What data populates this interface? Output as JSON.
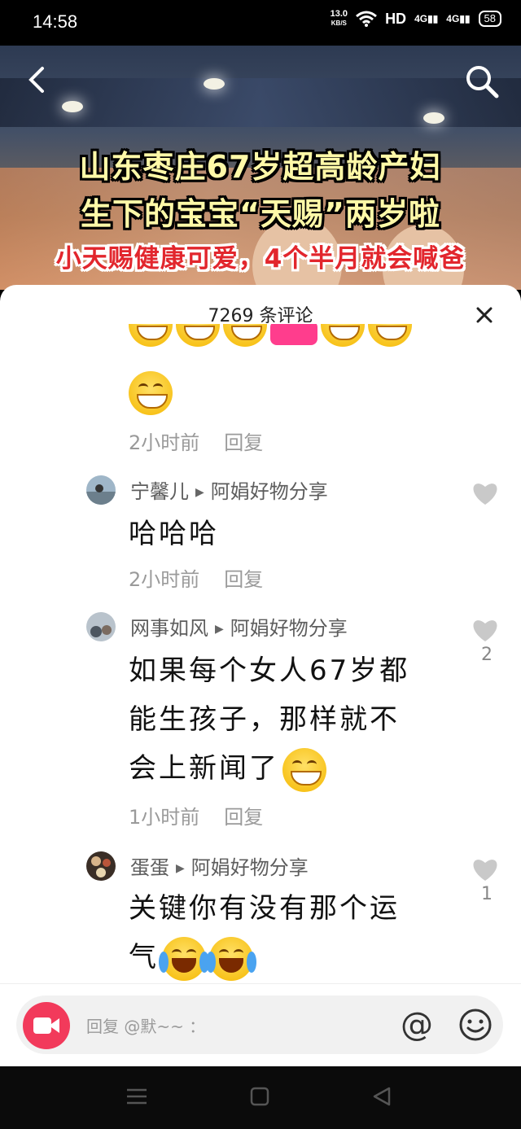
{
  "status_bar": {
    "time": "14:58",
    "net_speed": "13.0",
    "net_unit": "KB/S",
    "hd": "HD",
    "sig1": "4G",
    "sig2": "4G",
    "battery": "58",
    "icons": [
      "wifi-icon",
      "signal-icon",
      "battery-icon"
    ]
  },
  "video": {
    "title_line1": "山东枣庄67岁超高龄产妇",
    "title_line2": "生下的宝宝“天赐”两岁啦",
    "title_line3": "小天赐健康可爱，4个半月就会喊爸",
    "back_icon": "back-arrow-icon",
    "search_icon": "search-icon"
  },
  "comments_sheet": {
    "count_label": "7269 条评论",
    "close_icon": "close-icon",
    "first_comment": {
      "time": "2小时前",
      "reply": "回复"
    },
    "comments": [
      {
        "user": "宁馨儿",
        "reply_to": "阿娟好物分享",
        "text": "哈哈哈",
        "time": "2小时前",
        "reply": "回复",
        "likes": ""
      },
      {
        "user": "网事如风",
        "reply_to": "阿娟好物分享",
        "text_line1": "如果每个女人67岁都",
        "text_line2": "能生孩子，那样就不",
        "text_line3": "会上新闻了",
        "time": "1小时前",
        "reply": "回复",
        "likes": "2"
      },
      {
        "user": "蛋蛋",
        "reply_to": "阿娟好物分享",
        "text_line1": "关键你有没有那个运",
        "text_line2": "气",
        "likes": "1"
      }
    ]
  },
  "input_bar": {
    "placeholder": "回复 @默~~ ：",
    "at_label": "@",
    "camera_icon": "video-camera-icon",
    "emoji_icon": "smiley-icon"
  },
  "nav_bar": {
    "icons": [
      "menu-icon",
      "home-icon",
      "back-icon"
    ]
  },
  "colors": {
    "accent": "#f23a5b",
    "title_yellow": "#fff9a8",
    "title_red": "#e2262d"
  }
}
